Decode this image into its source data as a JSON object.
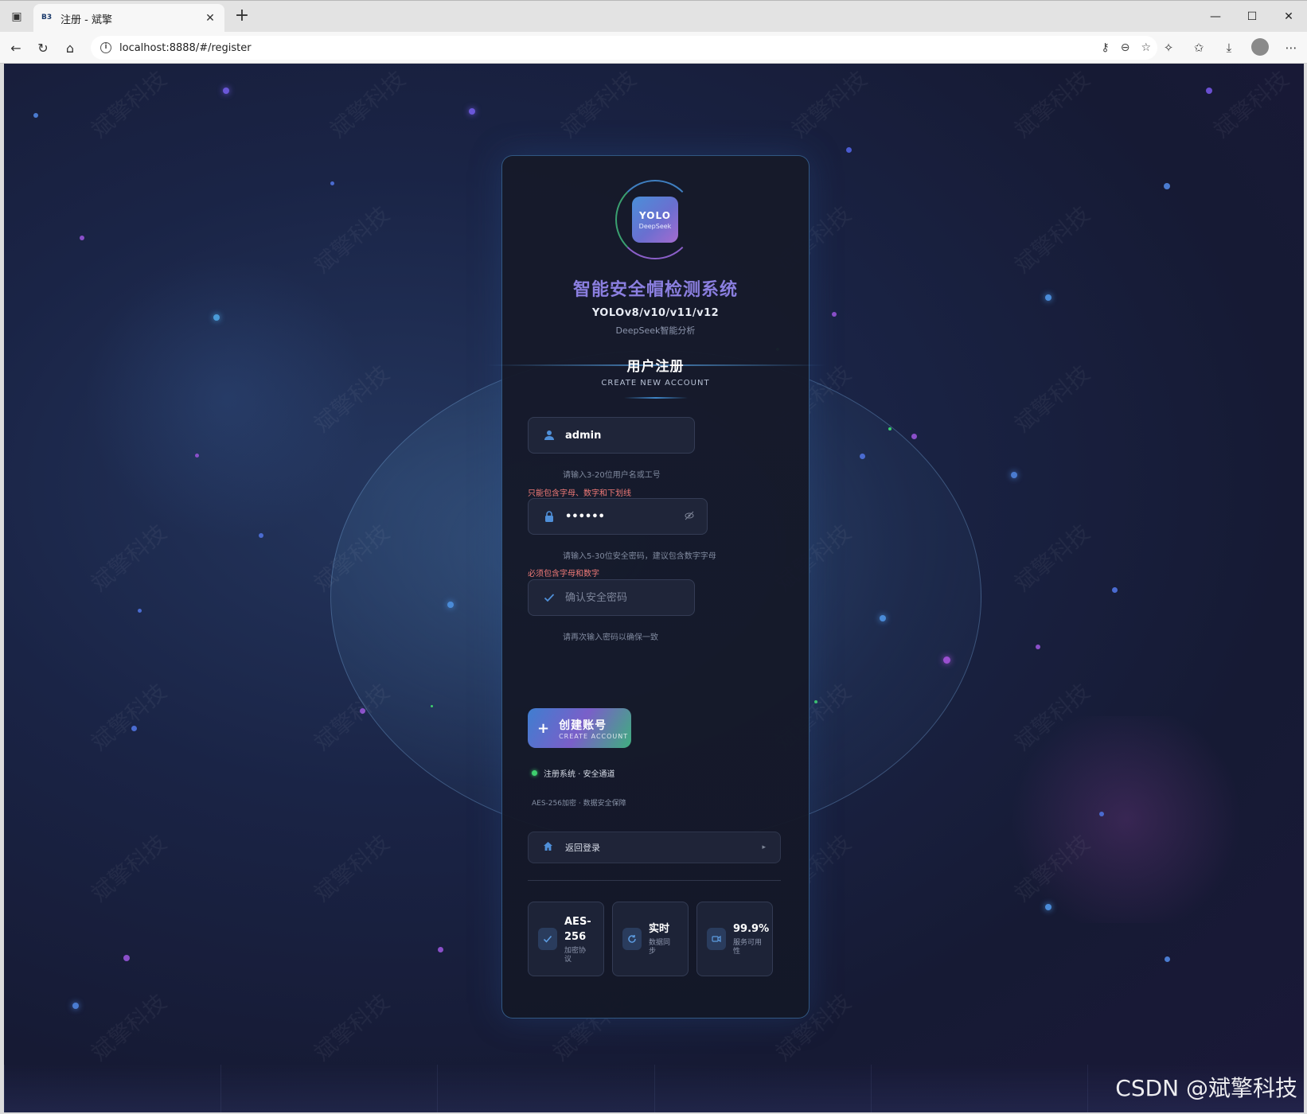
{
  "browser": {
    "tab_title": "注册 - 斌擎",
    "tab_favicon": "B3",
    "url": "localhost:8888/#/register"
  },
  "card": {
    "logo_main": "YOLO",
    "logo_sub": "DeepSeek",
    "title": "智能安全帽检测系统",
    "subtitle": "YOLOv8/v10/v11/v12",
    "subtitle2": "DeepSeek智能分析",
    "register_title": "用户注册",
    "register_sub": "CREATE NEW ACCOUNT"
  },
  "form": {
    "username": {
      "value": "admin",
      "hint": "请输入3-20位用户名或工号",
      "error": "只能包含字母、数字和下划线"
    },
    "password": {
      "value": "••••••",
      "hint": "请输入5-30位安全密码，建议包含数字字母",
      "error": "必须包含字母和数字"
    },
    "confirm": {
      "placeholder": "确认安全密码",
      "hint": "请再次输入密码以确保一致"
    }
  },
  "create_button": {
    "label": "创建账号",
    "sub": "CREATE ACCOUNT"
  },
  "status": {
    "text": "注册系统 · 安全通道",
    "sub": "AES-256加密 · 数据安全保障"
  },
  "back_link": {
    "label": "返回登录"
  },
  "stats": [
    {
      "value_line1": "AES-",
      "value_line2": "256",
      "label_line1": "加密协",
      "label_line2": "议",
      "icon": "check-icon"
    },
    {
      "value_line1": "实时",
      "label_line1": "数据同",
      "label_line2": "步",
      "icon": "sync-icon"
    },
    {
      "value_line1": "99.9%",
      "label_line1": "服务可用",
      "label_line2": "性",
      "icon": "video-icon"
    }
  ],
  "watermark": {
    "text": "斌擎科技",
    "csdn": "CSDN @斌擎科技"
  },
  "colors": {
    "accent": "#4f8fd8",
    "error": "#f07a78",
    "status_green": "#3ecf6e"
  }
}
